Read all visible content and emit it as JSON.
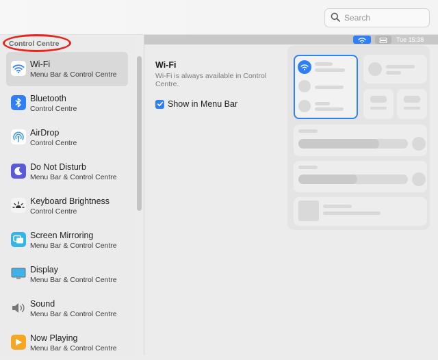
{
  "titlebar": {
    "faded_title": "",
    "search": {
      "placeholder": "Search",
      "icon": "magnifier-icon"
    }
  },
  "sidebar": {
    "section_header": "Control Centre",
    "items": [
      {
        "title": "Wi-Fi",
        "subtitle": "Menu Bar & Control Centre",
        "icon": "wifi-icon",
        "selected": true
      },
      {
        "title": "Bluetooth",
        "subtitle": "Control Centre",
        "icon": "bluetooth-icon"
      },
      {
        "title": "AirDrop",
        "subtitle": "Control Centre",
        "icon": "airdrop-icon"
      },
      {
        "title": "Do Not Disturb",
        "subtitle": "Menu Bar & Control Centre",
        "icon": "moon-icon"
      },
      {
        "title": "Keyboard Brightness",
        "subtitle": "Control Centre",
        "icon": "keyboard-brightness-icon"
      },
      {
        "title": "Screen Mirroring",
        "subtitle": "Menu Bar & Control Centre",
        "icon": "screen-mirroring-icon"
      },
      {
        "title": "Display",
        "subtitle": "Menu Bar & Control Centre",
        "icon": "display-icon"
      },
      {
        "title": "Sound",
        "subtitle": "Menu Bar & Control Centre",
        "icon": "speaker-icon"
      },
      {
        "title": "Now Playing",
        "subtitle": "Menu Bar & Control Centre",
        "icon": "now-playing-icon"
      }
    ]
  },
  "menubar_preview": {
    "time": "Tue 15:38"
  },
  "detail": {
    "title": "Wi-Fi",
    "description": "Wi-Fi is always available in Control Centre.",
    "checkbox": {
      "label": "Show in Menu Bar",
      "checked": true
    }
  },
  "colors": {
    "accent": "#2f7ff6",
    "annotation": "#e5261f"
  }
}
